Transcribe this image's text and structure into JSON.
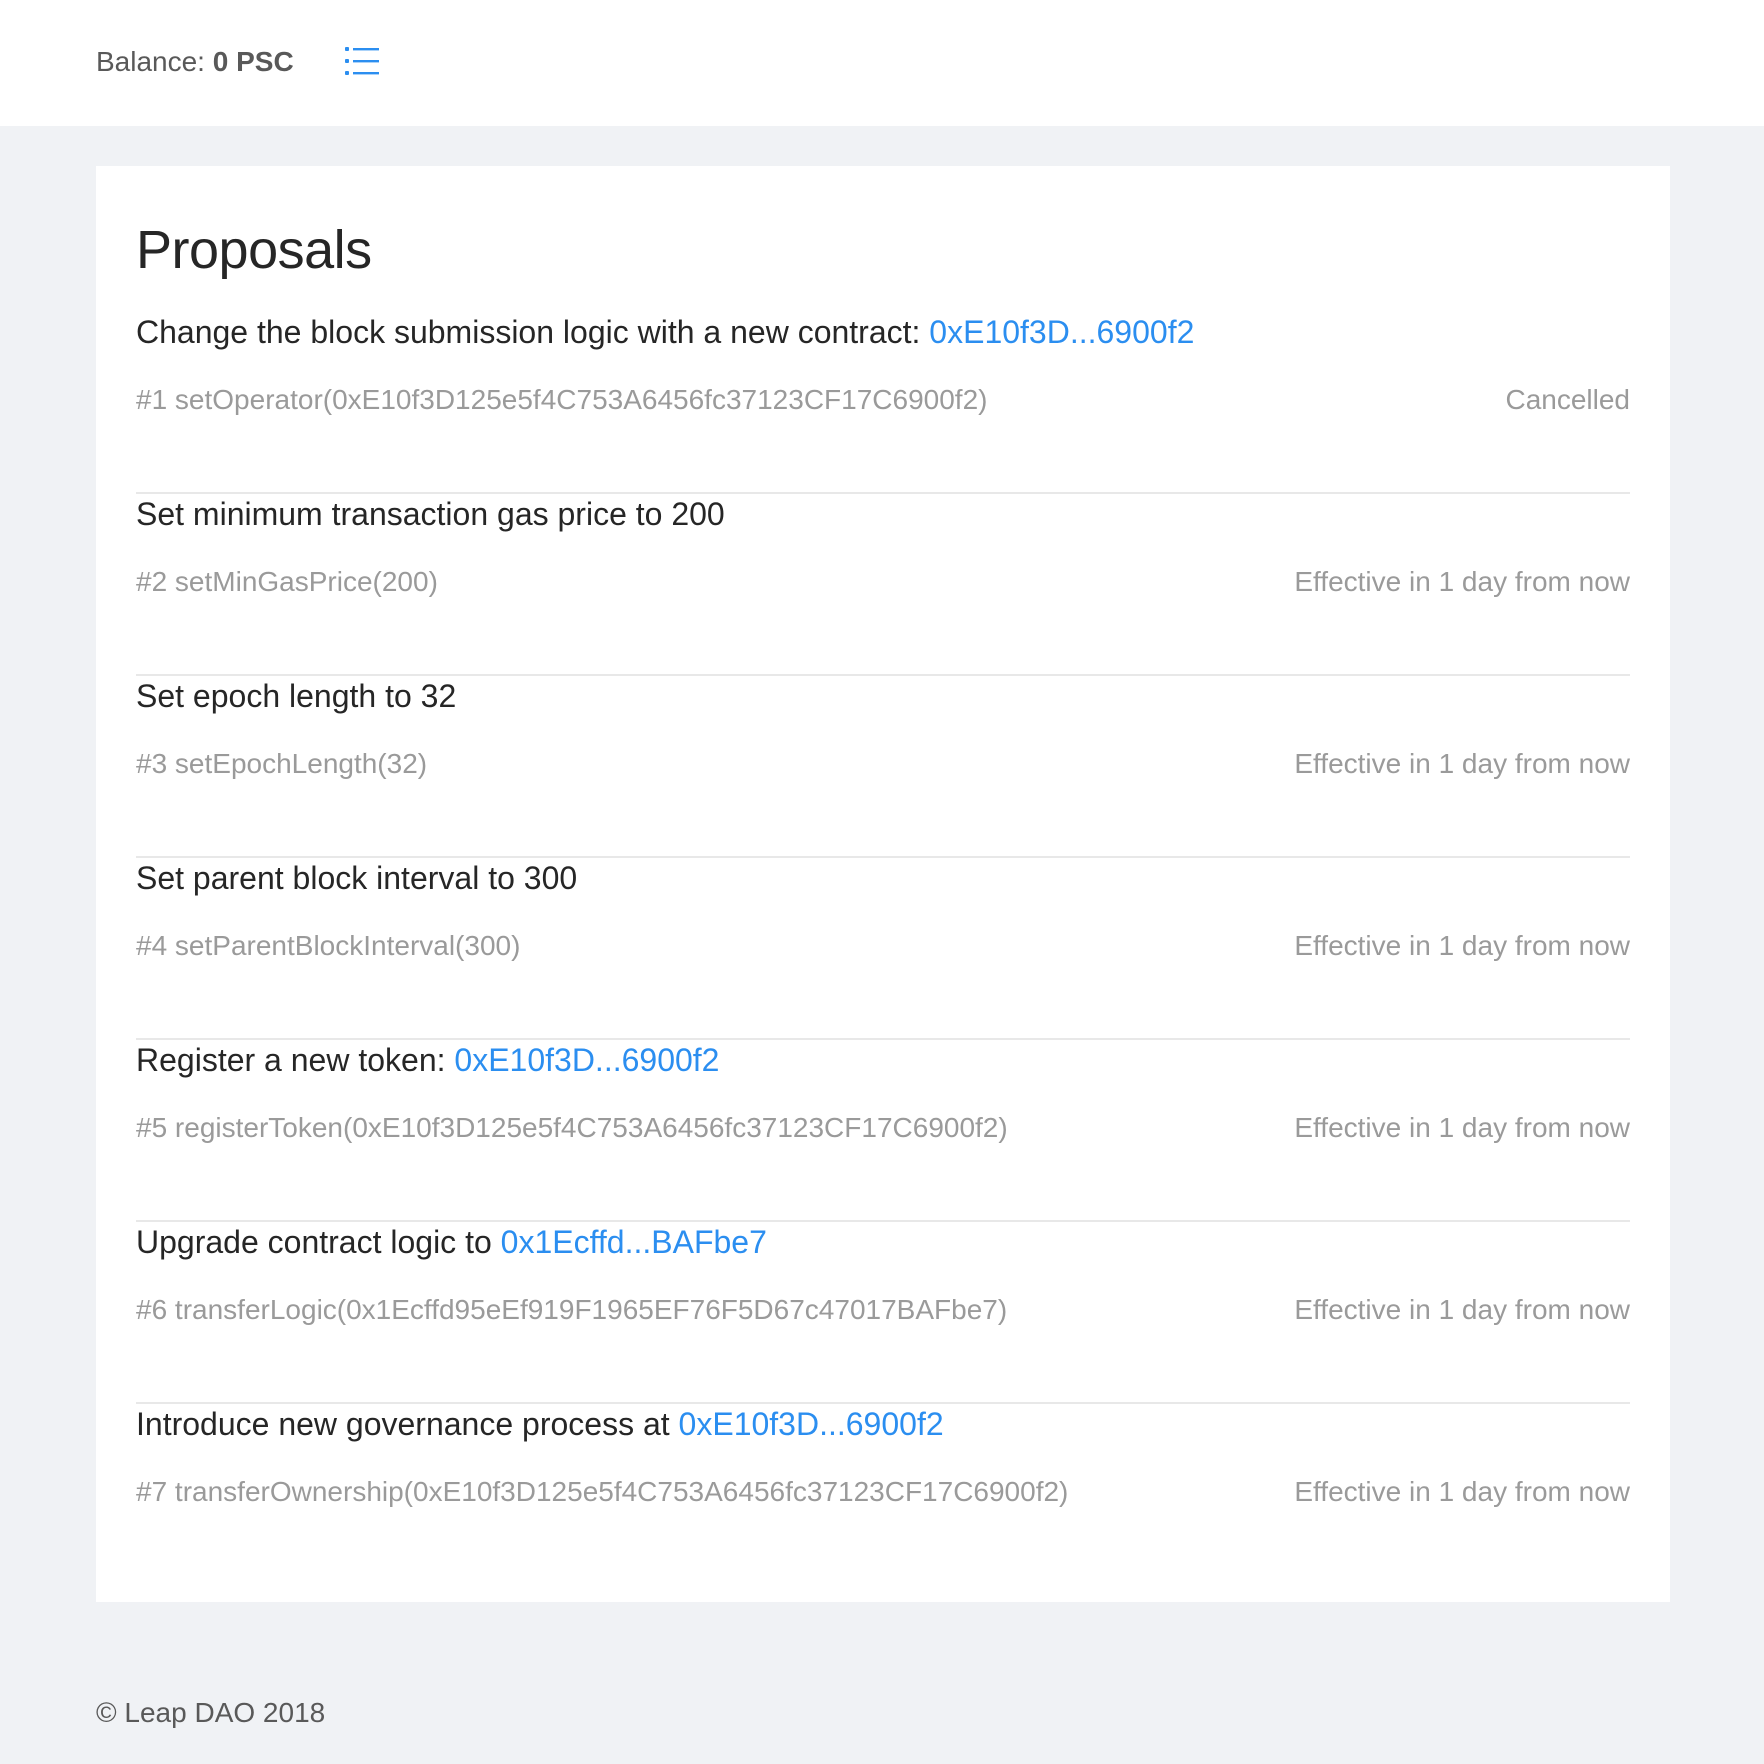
{
  "header": {
    "balance_label": "Balance:",
    "balance_value": "0 PSC",
    "menu_icon": "list-icon",
    "accent_color": "#2b8ef0"
  },
  "main": {
    "title": "Proposals",
    "proposals": [
      {
        "title_text": "Change the block submission logic with a new contract:",
        "link": "0xE10f3D...6900f2",
        "call": "#1 setOperator(0xE10f3D125e5f4C753A6456fc37123CF17C6900f2)",
        "status": "Cancelled"
      },
      {
        "title_text": "Set minimum transaction gas price to 200",
        "link": "",
        "call": "#2 setMinGasPrice(200)",
        "status": "Effective in 1 day from now"
      },
      {
        "title_text": "Set epoch length to 32",
        "link": "",
        "call": "#3 setEpochLength(32)",
        "status": "Effective in 1 day from now"
      },
      {
        "title_text": "Set parent block interval to 300",
        "link": "",
        "call": "#4 setParentBlockInterval(300)",
        "status": "Effective in 1 day from now"
      },
      {
        "title_text": "Register a new token:",
        "link": "0xE10f3D...6900f2",
        "call": "#5 registerToken(0xE10f3D125e5f4C753A6456fc37123CF17C6900f2)",
        "status": "Effective in 1 day from now"
      },
      {
        "title_text": "Upgrade contract logic to",
        "link": "0x1Ecffd...BAFbe7",
        "call": "#6 transferLogic(0x1Ecffd95eEf919F1965EF76F5D67c47017BAFbe7)",
        "status": "Effective in 1 day from now"
      },
      {
        "title_text": "Introduce new governance process at",
        "link": "0xE10f3D...6900f2",
        "call": "#7 transferOwnership(0xE10f3D125e5f4C753A6456fc37123CF17C6900f2)",
        "status": "Effective in 1 day from now"
      }
    ]
  },
  "footer": {
    "copyright": "© Leap DAO 2018"
  }
}
